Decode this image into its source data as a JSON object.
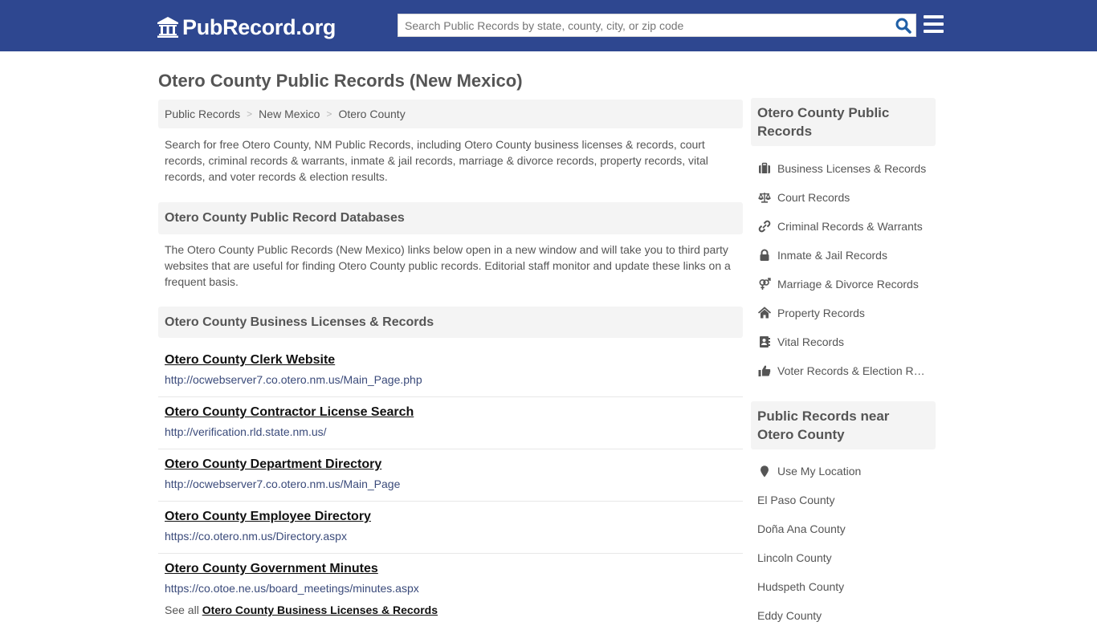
{
  "header": {
    "logo_text": "PubRecord.org",
    "logo_icon": "courthouse-icon",
    "search_placeholder": "Search Public Records by state, county, city, or zip code",
    "search_value": "",
    "search_icon": "search-icon",
    "menu_icon": "hamburger-menu-icon"
  },
  "colors": {
    "header_bg": "#2e4790",
    "panel_bg": "#f4f4f4",
    "link_url": "#3a4a7a",
    "search_icon": "#1f5fa6"
  },
  "page": {
    "title": "Otero County Public Records (New Mexico)"
  },
  "breadcrumb": [
    {
      "label": "Public Records"
    },
    {
      "label": "New Mexico"
    },
    {
      "label": "Otero County"
    }
  ],
  "breadcrumb_separator": ">",
  "intro": "Search for free Otero County, NM Public Records, including Otero County business licenses & records, court records, criminal records & warrants, inmate & jail records, marriage & divorce records, property records, vital records, and voter records & election results.",
  "databases": {
    "heading": "Otero County Public Record Databases",
    "text": "The Otero County Public Records (New Mexico) links below open in a new window and will take you to third party websites that are useful for finding Otero County public records. Editorial staff monitor and update these links on a frequent basis."
  },
  "business": {
    "heading": "Otero County Business Licenses & Records",
    "links": [
      {
        "title": "Otero County Clerk Website",
        "url": "http://ocwebserver7.co.otero.nm.us/Main_Page.php"
      },
      {
        "title": "Otero County Contractor License Search",
        "url": "http://verification.rld.state.nm.us/"
      },
      {
        "title": "Otero County Department Directory",
        "url": "http://ocwebserver7.co.otero.nm.us/Main_Page"
      },
      {
        "title": "Otero County Employee Directory",
        "url": "https://co.otero.nm.us/Directory.aspx"
      },
      {
        "title": "Otero County Government Minutes",
        "url": "https://co.otoe.ne.us/board_meetings/minutes.aspx"
      }
    ],
    "see_all_prefix": "See all",
    "see_all_link": "Otero County Business Licenses & Records"
  },
  "sidebar": {
    "records_heading": "Otero County Public Records",
    "records": [
      {
        "label": "Business Licenses & Records",
        "icon": "briefcase-icon"
      },
      {
        "label": "Court Records",
        "icon": "balance-scale-icon"
      },
      {
        "label": "Criminal Records & Warrants",
        "icon": "link-icon"
      },
      {
        "label": "Inmate & Jail Records",
        "icon": "lock-icon"
      },
      {
        "label": "Marriage & Divorce Records",
        "icon": "venus-mars-icon"
      },
      {
        "label": "Property Records",
        "icon": "home-icon"
      },
      {
        "label": "Vital Records",
        "icon": "address-book-icon"
      },
      {
        "label": "Voter Records & Election Results",
        "icon": "thumbs-up-icon"
      }
    ],
    "near_heading": "Public Records near Otero County",
    "use_location": {
      "label": "Use My Location",
      "icon": "map-marker-icon"
    },
    "nearby": [
      {
        "label": "El Paso County"
      },
      {
        "label": "Doña Ana County"
      },
      {
        "label": "Lincoln County"
      },
      {
        "label": "Hudspeth County"
      },
      {
        "label": "Eddy County"
      }
    ]
  }
}
